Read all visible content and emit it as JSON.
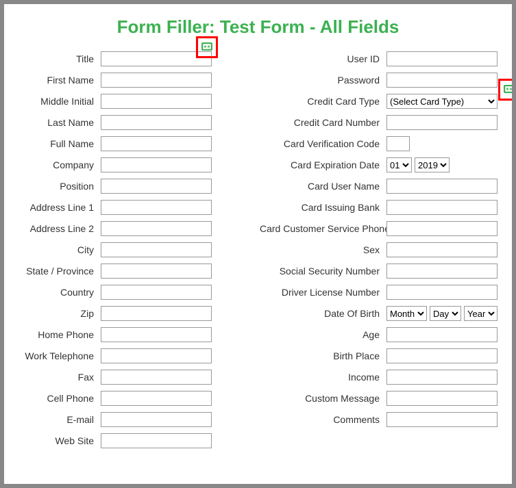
{
  "header": {
    "title": "Form Filler: Test Form - All Fields"
  },
  "left": {
    "title": "Title",
    "first_name": "First Name",
    "middle_initial": "Middle Initial",
    "last_name": "Last Name",
    "full_name": "Full Name",
    "company": "Company",
    "position": "Position",
    "address1": "Address Line 1",
    "address2": "Address Line 2",
    "city": "City",
    "state": "State / Province",
    "country": "Country",
    "zip": "Zip",
    "home_phone": "Home Phone",
    "work_phone": "Work Telephone",
    "fax": "Fax",
    "cell_phone": "Cell Phone",
    "email": "E-mail",
    "website": "Web Site"
  },
  "right": {
    "user_id": "User ID",
    "password": "Password",
    "cc_type": "Credit Card Type",
    "cc_type_selected": "(Select Card Type)",
    "cc_number": "Credit Card Number",
    "cvc": "Card Verification Code",
    "cc_exp": "Card Expiration Date",
    "cc_exp_month": "01",
    "cc_exp_year": "2019",
    "card_user": "Card User Name",
    "card_bank": "Card Issuing Bank",
    "card_cs": "Card Customer Service Phone",
    "sex": "Sex",
    "ssn": "Social Security Number",
    "dln": "Driver License Number",
    "dob": "Date Of Birth",
    "dob_month": "Month",
    "dob_day": "Day",
    "dob_year": "Year",
    "age": "Age",
    "birth_place": "Birth Place",
    "income": "Income",
    "custom_msg": "Custom Message",
    "comments": "Comments"
  }
}
